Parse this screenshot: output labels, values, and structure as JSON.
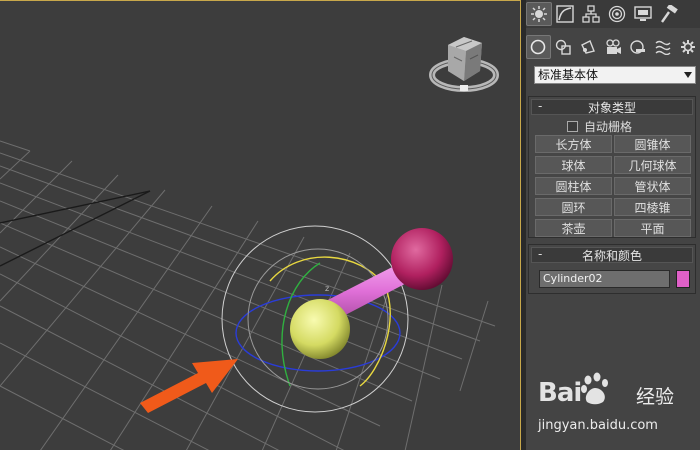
{
  "viewport": {
    "label": "perspective-viewport",
    "gizmo_axis_label": "z",
    "objects": [
      "sphere-yellow",
      "cylinder-pink",
      "sphere-magenta"
    ]
  },
  "command_panel": {
    "top_tabs": [
      {
        "name": "create-tab",
        "icon": "sun-icon",
        "active": true
      },
      {
        "name": "modify-tab",
        "icon": "curve-icon",
        "active": false
      },
      {
        "name": "hierarchy-tab",
        "icon": "hierarchy-icon",
        "active": false
      },
      {
        "name": "motion-tab",
        "icon": "motion-icon",
        "active": false
      },
      {
        "name": "display-tab",
        "icon": "monitor-icon",
        "active": false
      },
      {
        "name": "utilities-tab",
        "icon": "hammer-icon",
        "active": false
      }
    ],
    "sub_tabs": [
      {
        "name": "geometry-tab",
        "icon": "sphere-icon",
        "active": true
      },
      {
        "name": "shapes-tab",
        "icon": "shapes-icon",
        "active": false
      },
      {
        "name": "lights-tab",
        "icon": "light-icon",
        "active": false
      },
      {
        "name": "cameras-tab",
        "icon": "camera-icon",
        "active": false
      },
      {
        "name": "helpers-tab",
        "icon": "tape-icon",
        "active": false
      },
      {
        "name": "spacewarps-tab",
        "icon": "wave-icon",
        "active": false
      },
      {
        "name": "systems-tab",
        "icon": "gear-icon",
        "active": false
      }
    ],
    "category": "标准基本体",
    "object_type": {
      "title": "对象类型",
      "collapse": "-",
      "autogrid_label": "自动栅格",
      "buttons": [
        "长方体",
        "圆锥体",
        "球体",
        "几何球体",
        "圆柱体",
        "管状体",
        "圆环",
        "四棱锥",
        "茶壶",
        "平面"
      ]
    },
    "name_color": {
      "title": "名称和颜色",
      "collapse": "-",
      "name_value": "Cylinder02",
      "color": "#e060c8"
    }
  },
  "watermark": {
    "brand_left": "Bai",
    "brand_right": "经验",
    "url": "jingyan.baidu.com"
  },
  "colors": {
    "arrow": "#f05a1a",
    "yellow_sphere": "#d8e070",
    "magenta_sphere": "#b8206a",
    "cylinder": "#e070d8"
  }
}
